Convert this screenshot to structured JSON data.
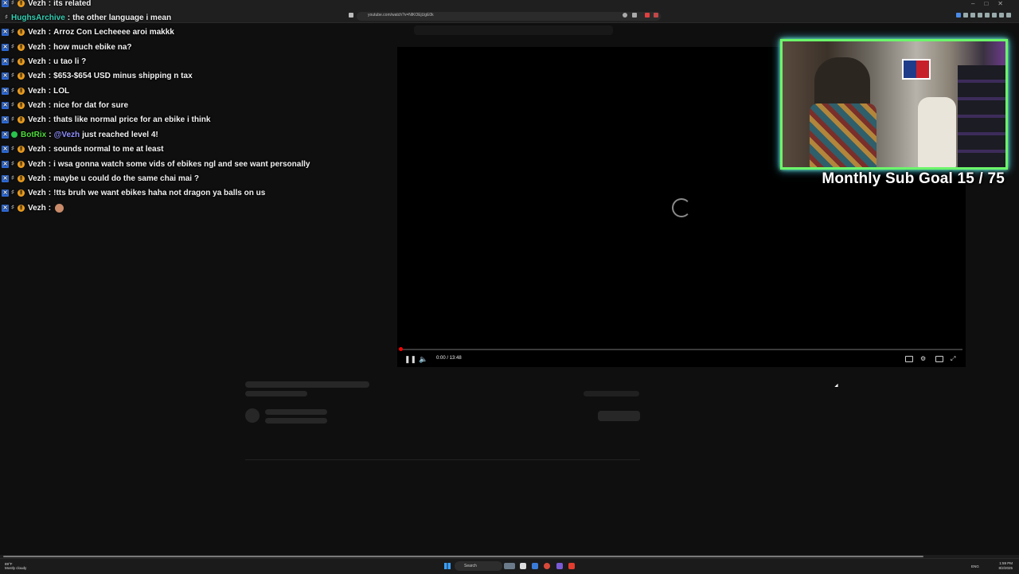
{
  "browser": {
    "url": "youtube.com/watch?v=NlKOEjUgE0k"
  },
  "chat": {
    "messages": [
      {
        "user": "Vezh",
        "sep": ":",
        "text": "its related",
        "type": "vezh"
      },
      {
        "user": "HughsArchive",
        "sep": ":",
        "text": "the other language i mean",
        "type": "hughs"
      },
      {
        "user": "Vezh",
        "sep": ":",
        "text": "Arroz Con Lecheeee aroi makkk",
        "type": "vezh"
      },
      {
        "user": "Vezh",
        "sep": ":",
        "text": "how much ebike na?",
        "type": "vezh"
      },
      {
        "user": "Vezh",
        "sep": ":",
        "text": "u tao li ?",
        "type": "vezh"
      },
      {
        "user": "Vezh",
        "sep": ":",
        "text": "$653-$654 USD minus shipping n tax",
        "type": "vezh"
      },
      {
        "user": "Vezh",
        "sep": ":",
        "text": "LOL",
        "type": "vezh"
      },
      {
        "user": "Vezh",
        "sep": ":",
        "text": "nice for dat for sure",
        "type": "vezh"
      },
      {
        "user": "Vezh",
        "sep": ":",
        "text": "thats like normal price for an ebike i think",
        "type": "vezh"
      },
      {
        "user": "BotRix",
        "sep": ":",
        "mention": "@Vezh",
        "text": "just reached level 4!",
        "type": "bot"
      },
      {
        "user": "Vezh",
        "sep": ":",
        "text": "sounds normal to me at least",
        "type": "vezh"
      },
      {
        "user": "Vezh",
        "sep": ":",
        "text": "i wsa gonna watch some vids of ebikes ngl and see want personally",
        "type": "vezh"
      },
      {
        "user": "Vezh",
        "sep": ":",
        "text": "maybe u could do the same chai mai ?",
        "type": "vezh"
      },
      {
        "user": "Vezh",
        "sep": ":",
        "text": "!tts bruh we want ebikes haha not dragon ya balls on us",
        "type": "vezh"
      },
      {
        "user": "Vezh",
        "sep": ":",
        "text": "",
        "type": "vezh",
        "emote": true
      }
    ]
  },
  "player": {
    "time": "0:00 / 13:48",
    "progress": 0.0
  },
  "overlay": {
    "sub_goal": "Monthly Sub Goal 15 / 75"
  },
  "taskbar": {
    "weather_temp": "89°F",
    "weather_desc": "Mostly cloudy",
    "search_placeholder": "Search",
    "lang": "ENG",
    "time": "1:59 PM",
    "date": "8/2/2025"
  },
  "colors": {
    "accent_red": "#ff0000",
    "webcam_border": "#6cf56a",
    "webcam_glow": "#49d6ff"
  }
}
